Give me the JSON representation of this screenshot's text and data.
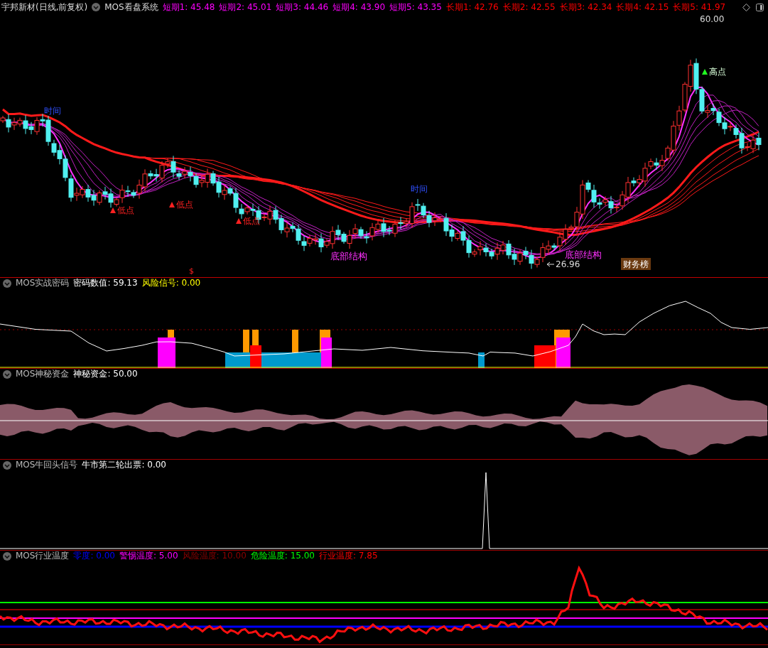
{
  "header": {
    "stock": "宇邦新材(日线,前复权)",
    "indicator": "MOS看盘系统",
    "values": [
      {
        "text": "短期1: 45.48",
        "color": "#ff00ff"
      },
      {
        "text": "短期2: 45.01",
        "color": "#ff00ff"
      },
      {
        "text": "短期3: 44.46",
        "color": "#ff00ff"
      },
      {
        "text": "短期4: 43.90",
        "color": "#ff00ff"
      },
      {
        "text": "短期5: 43.35",
        "color": "#ff00ff"
      },
      {
        "text": "长期1: 42.76",
        "color": "#ff0000"
      },
      {
        "text": "长期2: 42.55",
        "color": "#ff0000"
      },
      {
        "text": "长期3: 42.34",
        "color": "#ff0000"
      },
      {
        "text": "长期4: 42.15",
        "color": "#ff0000"
      },
      {
        "text": "长期5: 41.97",
        "color": "#ff0000"
      }
    ]
  },
  "main_chart": {
    "labels": [
      {
        "kind": "time",
        "text": "时间"
      },
      {
        "kind": "low",
        "text": "低点"
      },
      {
        "kind": "low",
        "text": "低点"
      },
      {
        "kind": "low",
        "text": "低点"
      },
      {
        "kind": "bottom",
        "text": "底部结构"
      },
      {
        "kind": "time",
        "text": "时间"
      },
      {
        "kind": "bottom",
        "text": "底部结构"
      },
      {
        "kind": "high",
        "text": "高点"
      },
      {
        "kind": "price",
        "text": "60.00"
      },
      {
        "kind": "arrow_price",
        "text": "26.96"
      },
      {
        "kind": "dollar",
        "text": "$"
      },
      {
        "kind": "badge",
        "text": "财务榜"
      }
    ]
  },
  "panels": [
    {
      "kind": "signal_bars",
      "title": "MOS实战密码",
      "values": [
        {
          "text": "密码数值: 59.13",
          "color": "#ffffff"
        },
        {
          "text": "风险信号: 0.00",
          "color": "#ffff00"
        }
      ]
    },
    {
      "kind": "fund_area",
      "title": "MOS神秘资金",
      "values": [
        {
          "text": "神秘资金: 50.00",
          "color": "#ffffff"
        }
      ]
    },
    {
      "kind": "spike",
      "title": "MOS牛回头信号",
      "values": [
        {
          "text": "牛市第二轮出票: 0.00",
          "color": "#ffffff"
        }
      ]
    },
    {
      "kind": "temperature",
      "title": "MOS行业温度",
      "values": [
        {
          "text": "零度: 0.00",
          "color": "#0000ff"
        },
        {
          "text": "警惕温度: 5.00",
          "color": "#ff00ff"
        },
        {
          "text": "风险温度: 10.00",
          "color": "#8b0000"
        },
        {
          "text": "危险温度: 15.00",
          "color": "#00ff00"
        },
        {
          "text": "行业温度: 7.85",
          "color": "#ff0000"
        }
      ]
    }
  ]
}
